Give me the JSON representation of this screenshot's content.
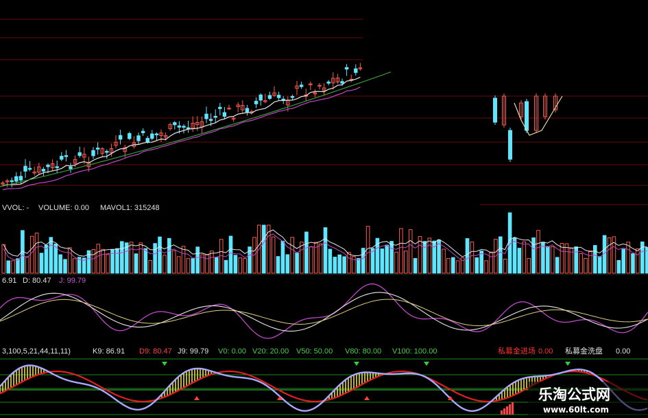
{
  "volume_header": {
    "label": "VVOL: -",
    "volume": "VOLUME: 0.00",
    "mavol": "MAVOL1: 315248"
  },
  "kdj_header": {
    "k": "6.91",
    "d": "D: 80.47",
    "j": "J: 99.79"
  },
  "indicator_header": {
    "params": "3,100,5,21,44,11,11)",
    "k9": "K9: 86.91",
    "d9": "D9: 80.47",
    "j9": "J9: 99.79",
    "v0": "V0: 0.00",
    "v20": "V20: 20.00",
    "v50": "V50: 50.00",
    "v80": "V80: 80.00",
    "v100": "V100: 100.00",
    "enter_label": "私募金进场",
    "enter_value": "0.00",
    "wash_label": "私募金洗盘",
    "wash_value": "0.00"
  },
  "watermark": {
    "title": "乐淘公式网",
    "url": "www.60lt.com"
  },
  "colors": {
    "background": "#000000",
    "up": "#ff5a4a",
    "down": "#5fe6ff",
    "ma_white": "#e8e8e8",
    "ma_purple": "#c048c8",
    "ma_green": "#3a9a3a",
    "level_red": "#a01010",
    "kline_red": "#e02020",
    "kline_yellow": "#f0e020",
    "kline_blue": "#a8a8ff",
    "arrow_green": "#30d040",
    "arrow_red": "#ff4040"
  },
  "chart_data": [
    {
      "type": "candlestick",
      "panel": "price",
      "series": [
        {
          "name": "candles",
          "values": []
        },
        {
          "name": "MA-short",
          "values": []
        },
        {
          "name": "MA-mid",
          "values": []
        },
        {
          "name": "MA-long",
          "values": []
        }
      ]
    },
    {
      "type": "bar",
      "panel": "volume",
      "series": [
        {
          "name": "VOLUME",
          "values": []
        },
        {
          "name": "MAVOL1",
          "values": []
        }
      ]
    },
    {
      "type": "line",
      "panel": "kdj",
      "series": [
        {
          "name": "K",
          "values": []
        },
        {
          "name": "D",
          "values": []
        },
        {
          "name": "J",
          "values": []
        }
      ]
    },
    {
      "type": "line",
      "panel": "indicator",
      "series": [
        {
          "name": "K9",
          "values": []
        },
        {
          "name": "D9",
          "values": []
        }
      ],
      "levels": [
        0,
        20,
        50,
        80,
        100
      ]
    }
  ]
}
